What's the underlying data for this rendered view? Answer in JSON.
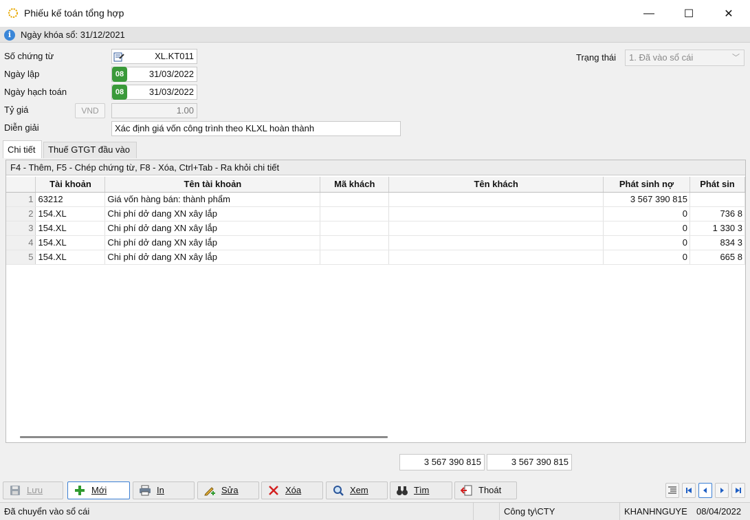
{
  "window": {
    "title": "Phiếu kế toán tổng hợp",
    "minimize": "—",
    "maximize": "☐",
    "close": "✕"
  },
  "info": {
    "lock_date": "Ngày khóa sổ: 31/12/2021"
  },
  "form": {
    "voucher_no_label": "Số chứng từ",
    "voucher_no": "XL.KT011",
    "date_created_label": "Ngày lập",
    "date_created_badge": "08",
    "date_created": "31/03/2022",
    "posting_date_label": "Ngày hạch toán",
    "posting_date_badge": "08",
    "posting_date": "31/03/2022",
    "rate_label": "Tỷ giá",
    "currency": "VND",
    "rate": "1.00",
    "description_label": "Diễn giải",
    "description": "Xác định giá vốn công trình theo KLXL hoàn thành",
    "status_label": "Trạng thái",
    "status": "1. Đã vào sổ cái"
  },
  "tabs": [
    "Chi tiết",
    "Thuế GTGT đầu vào"
  ],
  "grid": {
    "hint": "F4 - Thêm, F5 - Chép chứng từ, F8 - Xóa, Ctrl+Tab - Ra khỏi chi tiết",
    "columns": [
      "",
      "Tài khoản",
      "Tên tài khoản",
      "Mã khách",
      "Tên khách",
      "Phát sinh nợ",
      "Phát sin"
    ],
    "rows": [
      {
        "n": "1",
        "account": "63212",
        "name": "Giá vốn hàng bán: thành phẩm",
        "cust_code": "",
        "cust_name": "",
        "debit": "3 567 390 815",
        "credit": ""
      },
      {
        "n": "2",
        "account": "154.XL",
        "name": "Chi phí dở dang XN xây lắp",
        "cust_code": "",
        "cust_name": "",
        "debit": "0",
        "credit": "736 8"
      },
      {
        "n": "3",
        "account": "154.XL",
        "name": "Chi phí dở dang XN xây lắp",
        "cust_code": "",
        "cust_name": "",
        "debit": "0",
        "credit": "1 330 3"
      },
      {
        "n": "4",
        "account": "154.XL",
        "name": "Chi phí dở dang XN xây lắp",
        "cust_code": "",
        "cust_name": "",
        "debit": "0",
        "credit": "834 3"
      },
      {
        "n": "5",
        "account": "154.XL",
        "name": "Chi phí dở dang XN xây lắp",
        "cust_code": "",
        "cust_name": "",
        "debit": "0",
        "credit": "665 8"
      }
    ]
  },
  "totals": {
    "debit": "3 567 390 815",
    "credit": "3 567 390 815"
  },
  "toolbar": {
    "save": "Lưu",
    "new": "Mới",
    "print": "In",
    "edit": "Sửa",
    "delete": "Xóa",
    "view": "Xem",
    "find": "Tìm",
    "exit": "Thoát"
  },
  "statusbar": {
    "state": "Đã chuyển vào sổ cái",
    "company": "Công ty\\CTY",
    "user": "KHANHNGUYE",
    "date": "08/04/2022"
  }
}
